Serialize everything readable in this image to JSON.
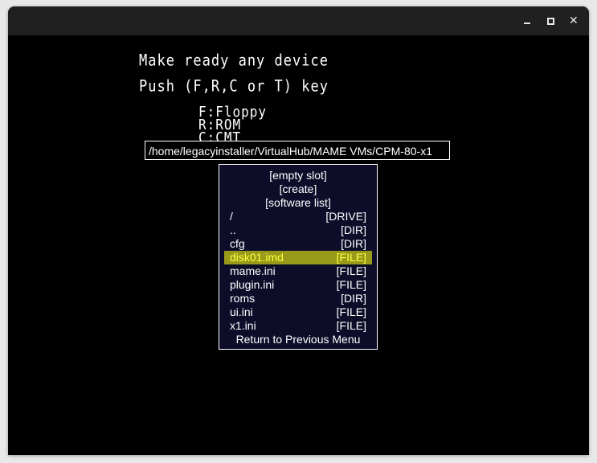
{
  "window": {
    "controls": {
      "minimize": "minimize",
      "maximize": "maximize",
      "close": "close"
    }
  },
  "emulator_screen": {
    "line1": "Make ready any device",
    "line2": "Push (F,R,C or T) key",
    "options": [
      "F:Floppy",
      "R:ROM",
      "C:CMT"
    ]
  },
  "file_selector": {
    "current_path": "/home/legacyinstaller/VirtualHub/MAME VMs/CPM-80-x1",
    "special_items": [
      "[empty slot]",
      "[create]",
      "[software list]"
    ],
    "entries": [
      {
        "name": "/",
        "type": "[DRIVE]"
      },
      {
        "name": "..",
        "type": "[DIR]"
      },
      {
        "name": "cfg",
        "type": "[DIR]"
      },
      {
        "name": "disk01.imd",
        "type": "[FILE]",
        "selected": true
      },
      {
        "name": "mame.ini",
        "type": "[FILE]"
      },
      {
        "name": "plugin.ini",
        "type": "[FILE]"
      },
      {
        "name": "roms",
        "type": "[DIR]"
      },
      {
        "name": "ui.ini",
        "type": "[FILE]"
      },
      {
        "name": "x1.ini",
        "type": "[FILE]"
      }
    ],
    "return_label": "Return to Previous Menu",
    "colors": {
      "menu_background": "#0d0d2a",
      "selected_background": "#9a9a1a",
      "selected_text": "#ffff40",
      "text": "#ffffff"
    }
  }
}
